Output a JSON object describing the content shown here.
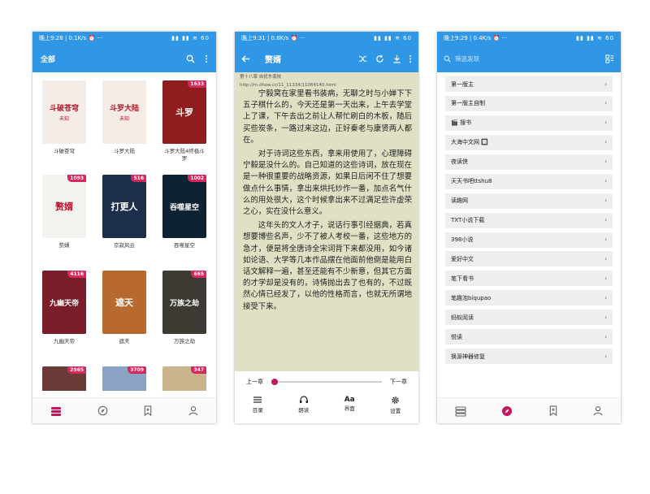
{
  "status": {
    "p1": {
      "time": "晚上9:28 | 0.1K/s ⏰ ···",
      "right": "▮▮ ▮▮ ≋ 60"
    },
    "p2": {
      "time": "晚上9:31 | 0.8K/s ⏰ ···",
      "right": "▮▮ ▮▮ ≋ 60"
    },
    "p3": {
      "time": "晚上9:29 | 0.4K/s ⏰ ···",
      "right": "▮▮ ▮▮ ≋ 60"
    }
  },
  "shelf": {
    "tab_label": "全部",
    "books": [
      {
        "name": "斗破苍穹",
        "cover_text": "斗破苍穹",
        "cover_sub": "未知",
        "badge": ""
      },
      {
        "name": "斗罗大陆",
        "cover_text": "斗罗大陆",
        "cover_sub": "未知",
        "badge": ""
      },
      {
        "name": "斗罗大陆4终极斗罗",
        "cover_text": "斗罗",
        "cover_sub": "",
        "badge": "1633"
      },
      {
        "name": "赘婿",
        "cover_text": "赘婿",
        "cover_sub": "",
        "badge": "1093"
      },
      {
        "name": "京寂风云",
        "cover_text": "打更人",
        "cover_sub": "",
        "badge": "516"
      },
      {
        "name": "吞噬星空",
        "cover_text": "吞噬星空",
        "cover_sub": "",
        "badge": "1002"
      },
      {
        "name": "九幽天帝",
        "cover_text": "九幽天帝",
        "cover_sub": "",
        "badge": "4116"
      },
      {
        "name": "遮天",
        "cover_text": "遮天",
        "cover_sub": "",
        "badge": ""
      },
      {
        "name": "万族之劫",
        "cover_text": "万族之劫",
        "cover_sub": "",
        "badge": "665"
      },
      {
        "name": "",
        "cover_text": "",
        "cover_sub": "",
        "badge": "2965"
      },
      {
        "name": "",
        "cover_text": "",
        "cover_sub": "",
        "badge": "3709"
      },
      {
        "name": "",
        "cover_text": "",
        "cover_sub": "",
        "badge": "347"
      }
    ],
    "cover_colors": [
      "#f4ece6",
      "#f3ebe4",
      "#8f1d1d",
      "#f2f2ee",
      "#1d2e4a",
      "#0f2233",
      "#7a1d2a",
      "#b8692e",
      "#3d3a33",
      "#6a3a36",
      "#8aa3c4",
      "#c9b48c"
    ]
  },
  "reader": {
    "title": "赘婿",
    "meta_line1": "第十八章 自扰东南枝",
    "meta_line2": "http://m.dhzw.cc/11_11334/11064140.html",
    "paragraphs": [
      "宁毅窝在家里看书装病，无聊之时与小婵下下五子棋什么的，今天还是第一天出来，上午去学堂上了课，下午去出之前让人帮忙刷白的木板，随后买些炭条，一路过来这边，正好秦老与康贤两人都在。",
      "对于诗词这些东西，拿来用使用了，心理障碍宁毅是没什么的。自己知道的这些诗词，放在现在是一种很重要的战略资源，如果日后闲不住了想要做点什么事情，拿出来烘托炒作一番，加点名气什么的用处很大，这个时候拿出来不过满足些许虚荣之心，实在没什么意义。",
      "这年头的文人才子，说话行事引经据典，若真想要博些名声，少不了被人考校一番，这些地方的急才，便是将全唐诗全宋词背下来都没用，如今诸如论语、大学等几本作品摆在他面前他倒是能用白话文解释一遍，甚至还能有不少新意，但其它方面的才学却是没有的，诗情抛出去了也有的，不过既然心情已经发了，以他的性格而言，也就无所谓地接受下来。"
    ],
    "prev": "上一章",
    "next": "下一章",
    "progress": 0.0,
    "tools": [
      "目录",
      "朗读",
      "界面",
      "设置"
    ]
  },
  "sources": {
    "search_placeholder": "筛选发现",
    "items": [
      "第一版主",
      "第一版主自制",
      "🎬 搜书",
      "大海中文网 🔲",
      "夜读侠",
      "天天书吧ttshu8",
      "读趣网",
      "TXT小说下载",
      "398小说",
      "爱好中文",
      "笔下看书",
      "笔趣泡biqupao",
      "蚂蚁阅读",
      "悦读",
      "换源神器修复"
    ]
  },
  "colors": {
    "accent": "#2f97e6",
    "highlight": "#c2185b",
    "badge": "#d6285b"
  }
}
